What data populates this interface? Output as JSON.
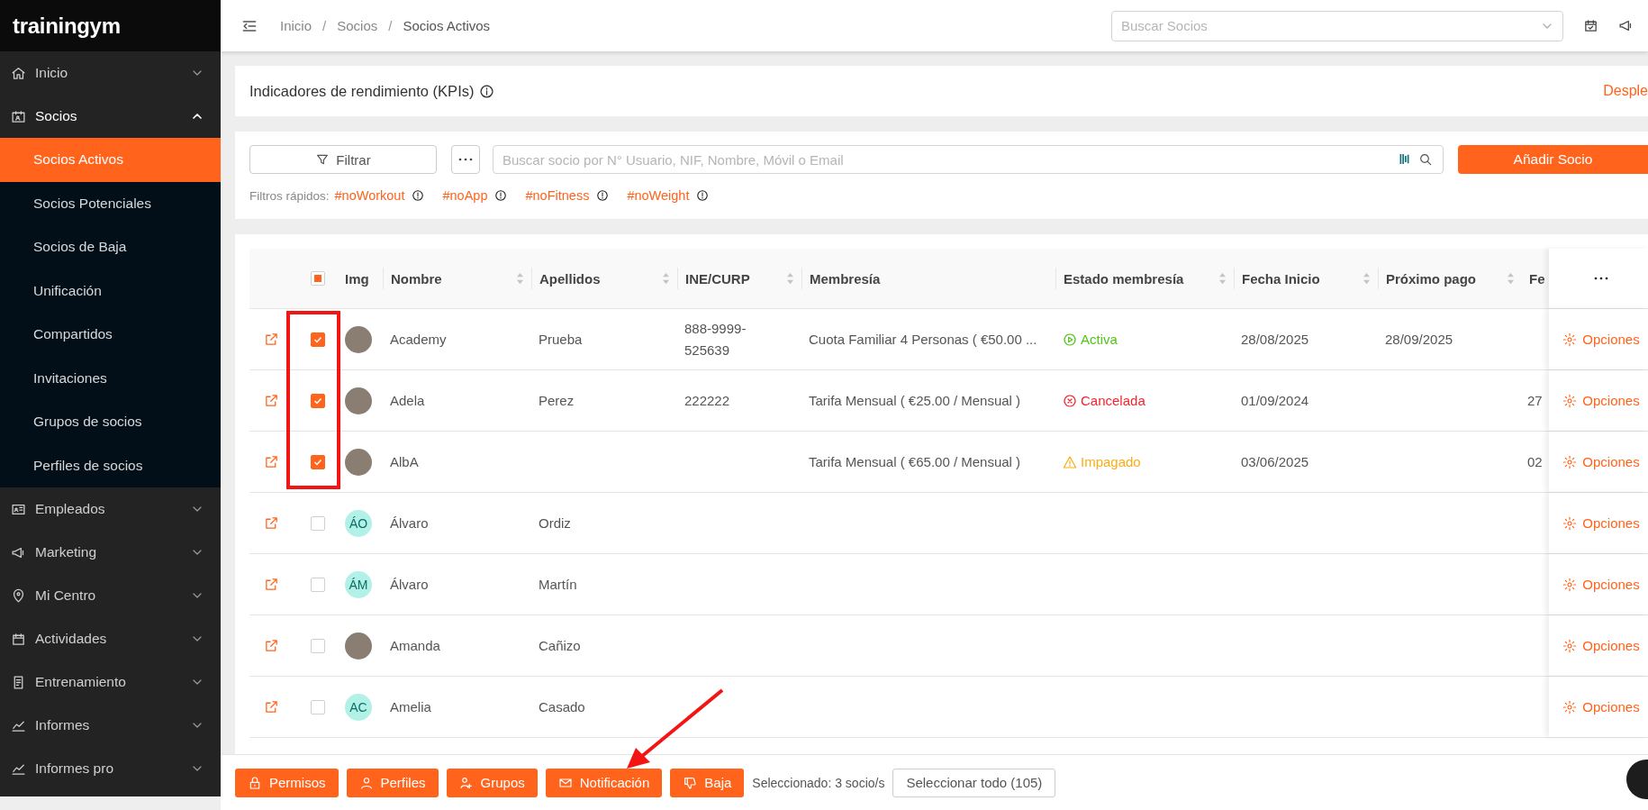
{
  "window": {
    "logo": "trainingym"
  },
  "sidebar": {
    "items": [
      {
        "label": "Inicio",
        "expanded": false
      },
      {
        "label": "Socios",
        "expanded": true,
        "children": [
          {
            "label": "Socios Activos",
            "selected": true
          },
          {
            "label": "Socios Potenciales",
            "selected": false
          },
          {
            "label": "Socios de Baja",
            "selected": false
          },
          {
            "label": "Unificación",
            "selected": false
          },
          {
            "label": "Compartidos",
            "selected": false
          },
          {
            "label": "Invitaciones",
            "selected": false
          },
          {
            "label": "Grupos de socios",
            "selected": false
          },
          {
            "label": "Perfiles de socios",
            "selected": false
          }
        ]
      },
      {
        "label": "Empleados",
        "expanded": false
      },
      {
        "label": "Marketing",
        "expanded": false
      },
      {
        "label": "Mi Centro",
        "expanded": false
      },
      {
        "label": "Actividades",
        "expanded": false
      },
      {
        "label": "Entrenamiento",
        "expanded": false
      },
      {
        "label": "Informes",
        "expanded": false
      },
      {
        "label": "Informes pro",
        "expanded": false
      }
    ]
  },
  "header": {
    "breadcrumb": [
      "Inicio",
      "Socios",
      "Socios Activos"
    ],
    "breadcrumb_separator": "/",
    "search": {
      "placeholder": "Buscar Socios"
    }
  },
  "kpi_panel": {
    "title": "Indicadores de rendimiento (KPIs)",
    "toggle": "Desple"
  },
  "filters": {
    "filter_button": "Filtrar",
    "search": {
      "placeholder": "Buscar socio por N° Usuario, NIF, Nombre, Móvil o Email"
    },
    "add_button": "Añadir Socio",
    "quick_filters_label": "Filtros rápidos:",
    "quick_filters": [
      "#noWorkout",
      "#noApp",
      "#noFitness",
      "#noWeight"
    ]
  },
  "table": {
    "select_all": {
      "indeterminate": true
    },
    "columns": [
      {
        "label": "Img",
        "sortable": false
      },
      {
        "label": "Nombre",
        "sortable": true
      },
      {
        "label": "Apellidos",
        "sortable": true
      },
      {
        "label": "INE/CURP",
        "sortable": true
      },
      {
        "label": "Membresía",
        "sortable": false
      },
      {
        "label": "Estado membresía",
        "sortable": true
      },
      {
        "label": "Fecha Inicio",
        "sortable": true
      },
      {
        "label": "Próximo pago",
        "sortable": true
      },
      {
        "label": "Fe"
      }
    ],
    "rows": [
      {
        "checked": true,
        "avatar": {
          "kind": "photo"
        },
        "nombre": "Academy",
        "apellidos": "Prueba",
        "ine_curp": "888-9999-525639",
        "membresia": "Cuota Familiar 4 Personas ( €50.00 ...",
        "estado": {
          "kind": "active",
          "text": "Activa"
        },
        "fecha_inicio": "28/08/2025",
        "proximo_pago": "28/09/2025",
        "options": "Opciones"
      },
      {
        "checked": true,
        "avatar": {
          "kind": "photo"
        },
        "nombre": "Adela",
        "apellidos": "Perez",
        "ine_curp": "222222",
        "membresia": "Tarifa Mensual ( €25.00 / Mensual )",
        "estado": {
          "kind": "cancelled",
          "text": "Cancelada"
        },
        "fecha_inicio": "01/09/2024",
        "column_9": "27",
        "options": "Opciones"
      },
      {
        "checked": true,
        "avatar": {
          "kind": "photo"
        },
        "nombre": "AlbA",
        "membresia": "Tarifa Mensual ( €65.00 / Mensual )",
        "estado": {
          "kind": "unpaid",
          "text": "Impagado"
        },
        "fecha_inicio": "03/06/2025",
        "column_9": "02",
        "options": "Opciones"
      },
      {
        "checked": false,
        "avatar": {
          "kind": "initials",
          "text": "ÁO"
        },
        "nombre": "Álvaro",
        "apellidos": "Ordiz",
        "options": "Opciones"
      },
      {
        "checked": false,
        "avatar": {
          "kind": "initials",
          "text": "ÁM"
        },
        "nombre": "Álvaro",
        "apellidos": "Martín",
        "options": "Opciones"
      },
      {
        "checked": false,
        "avatar": {
          "kind": "photo"
        },
        "nombre": "Amanda",
        "apellidos": "Cañizo",
        "options": "Opciones"
      },
      {
        "checked": false,
        "avatar": {
          "kind": "initials",
          "text": "AC"
        },
        "nombre": "Amelia",
        "apellidos": "Casado",
        "options": "Opciones"
      }
    ]
  },
  "action_bar": {
    "buttons": [
      "Permisos",
      "Perfiles",
      "Grupos",
      "Notificación",
      "Baja"
    ],
    "selection_text": "Seleccionado: 3 socio/s",
    "select_all_button": "Seleccionar todo (105)"
  },
  "annotations": {
    "highlight_box": true,
    "arrow": true
  }
}
